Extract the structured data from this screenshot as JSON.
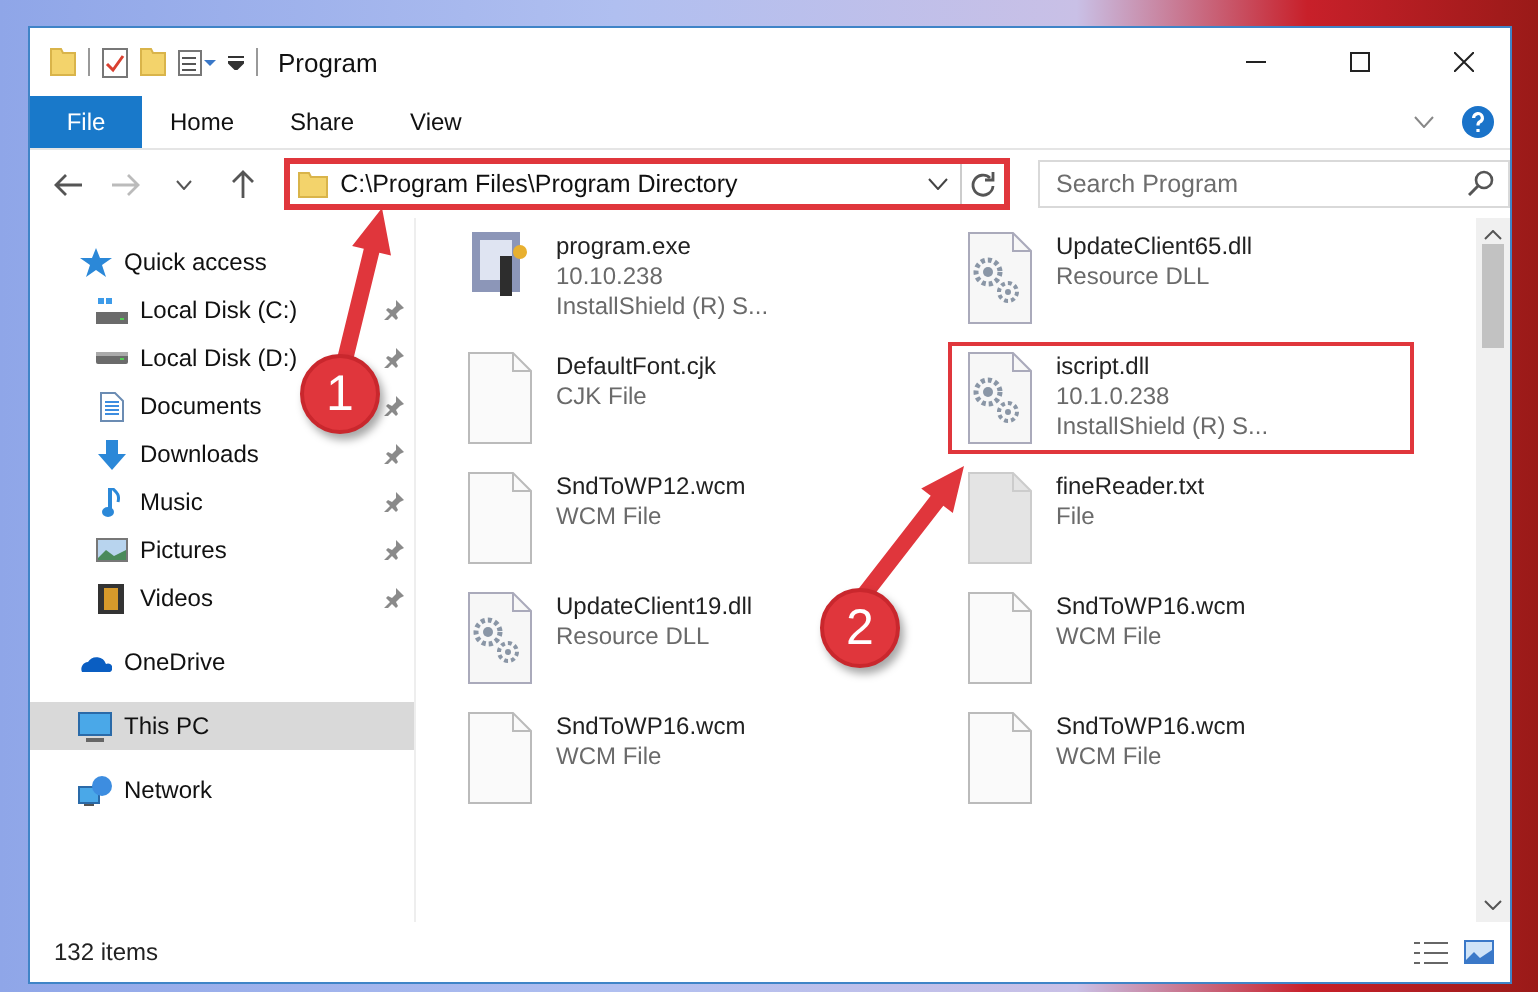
{
  "window": {
    "title": "Program"
  },
  "ribbon_tabs": [
    {
      "label": "File",
      "kind": "file",
      "selected": false
    },
    {
      "label": "Home",
      "kind": "tab",
      "selected": false
    },
    {
      "label": "Share",
      "kind": "tab",
      "selected": false
    },
    {
      "label": "View",
      "kind": "tab",
      "selected": false
    }
  ],
  "address_bar": {
    "path": "C:\\Program Files\\Program Directory",
    "highlighted": true
  },
  "search": {
    "placeholder": "Search Program"
  },
  "sidebar": {
    "items": [
      {
        "label": "Quick access",
        "selected": false,
        "children": [
          {
            "label": "Local Disk (C:)",
            "pinned": true,
            "selected": false
          },
          {
            "label": "Local Disk (D:)",
            "pinned": true,
            "selected": false
          },
          {
            "label": "Documents",
            "pinned": true,
            "selected": false
          },
          {
            "label": "Downloads",
            "pinned": true,
            "selected": false
          },
          {
            "label": "Music",
            "pinned": true,
            "selected": false
          },
          {
            "label": "Pictures",
            "pinned": true,
            "selected": false
          },
          {
            "label": "Videos",
            "pinned": true,
            "selected": false
          }
        ]
      },
      {
        "label": "OneDrive",
        "selected": false
      },
      {
        "label": "This PC",
        "selected": true
      },
      {
        "label": "Network",
        "selected": false
      }
    ]
  },
  "files": [
    {
      "name": "program.exe",
      "lines": [
        "10.10.238",
        "InstallShield (R) S..."
      ],
      "kind": "exe",
      "highlighted": false
    },
    {
      "name": "UpdateClient65.dll",
      "lines": [
        "Resource DLL"
      ],
      "kind": "dll",
      "highlighted": false
    },
    {
      "name": "DefaultFont.cjk",
      "lines": [
        "CJK File"
      ],
      "kind": "blank",
      "highlighted": false
    },
    {
      "name": "iscript.dll",
      "lines": [
        "10.1.0.238",
        "InstallShield (R) S..."
      ],
      "kind": "dll",
      "highlighted": true
    },
    {
      "name": "SndToWP12.wcm",
      "lines": [
        "WCM File"
      ],
      "kind": "blank",
      "highlighted": false
    },
    {
      "name": "fineReader.txt",
      "lines": [
        "File"
      ],
      "kind": "grey",
      "highlighted": false
    },
    {
      "name": "UpdateClient19.dll",
      "lines": [
        "Resource DLL"
      ],
      "kind": "dll",
      "highlighted": false
    },
    {
      "name": "SndToWP16.wcm",
      "lines": [
        "WCM File"
      ],
      "kind": "blank",
      "highlighted": false
    },
    {
      "name": "SndToWP16.wcm",
      "lines": [
        "WCM File"
      ],
      "kind": "blank",
      "highlighted": false
    },
    {
      "name": "SndToWP16.wcm",
      "lines": [
        "WCM File"
      ],
      "kind": "blank",
      "highlighted": false
    }
  ],
  "status_bar": {
    "count": "132 items"
  },
  "annotations": [
    {
      "label": "1"
    },
    {
      "label": "2"
    }
  ]
}
